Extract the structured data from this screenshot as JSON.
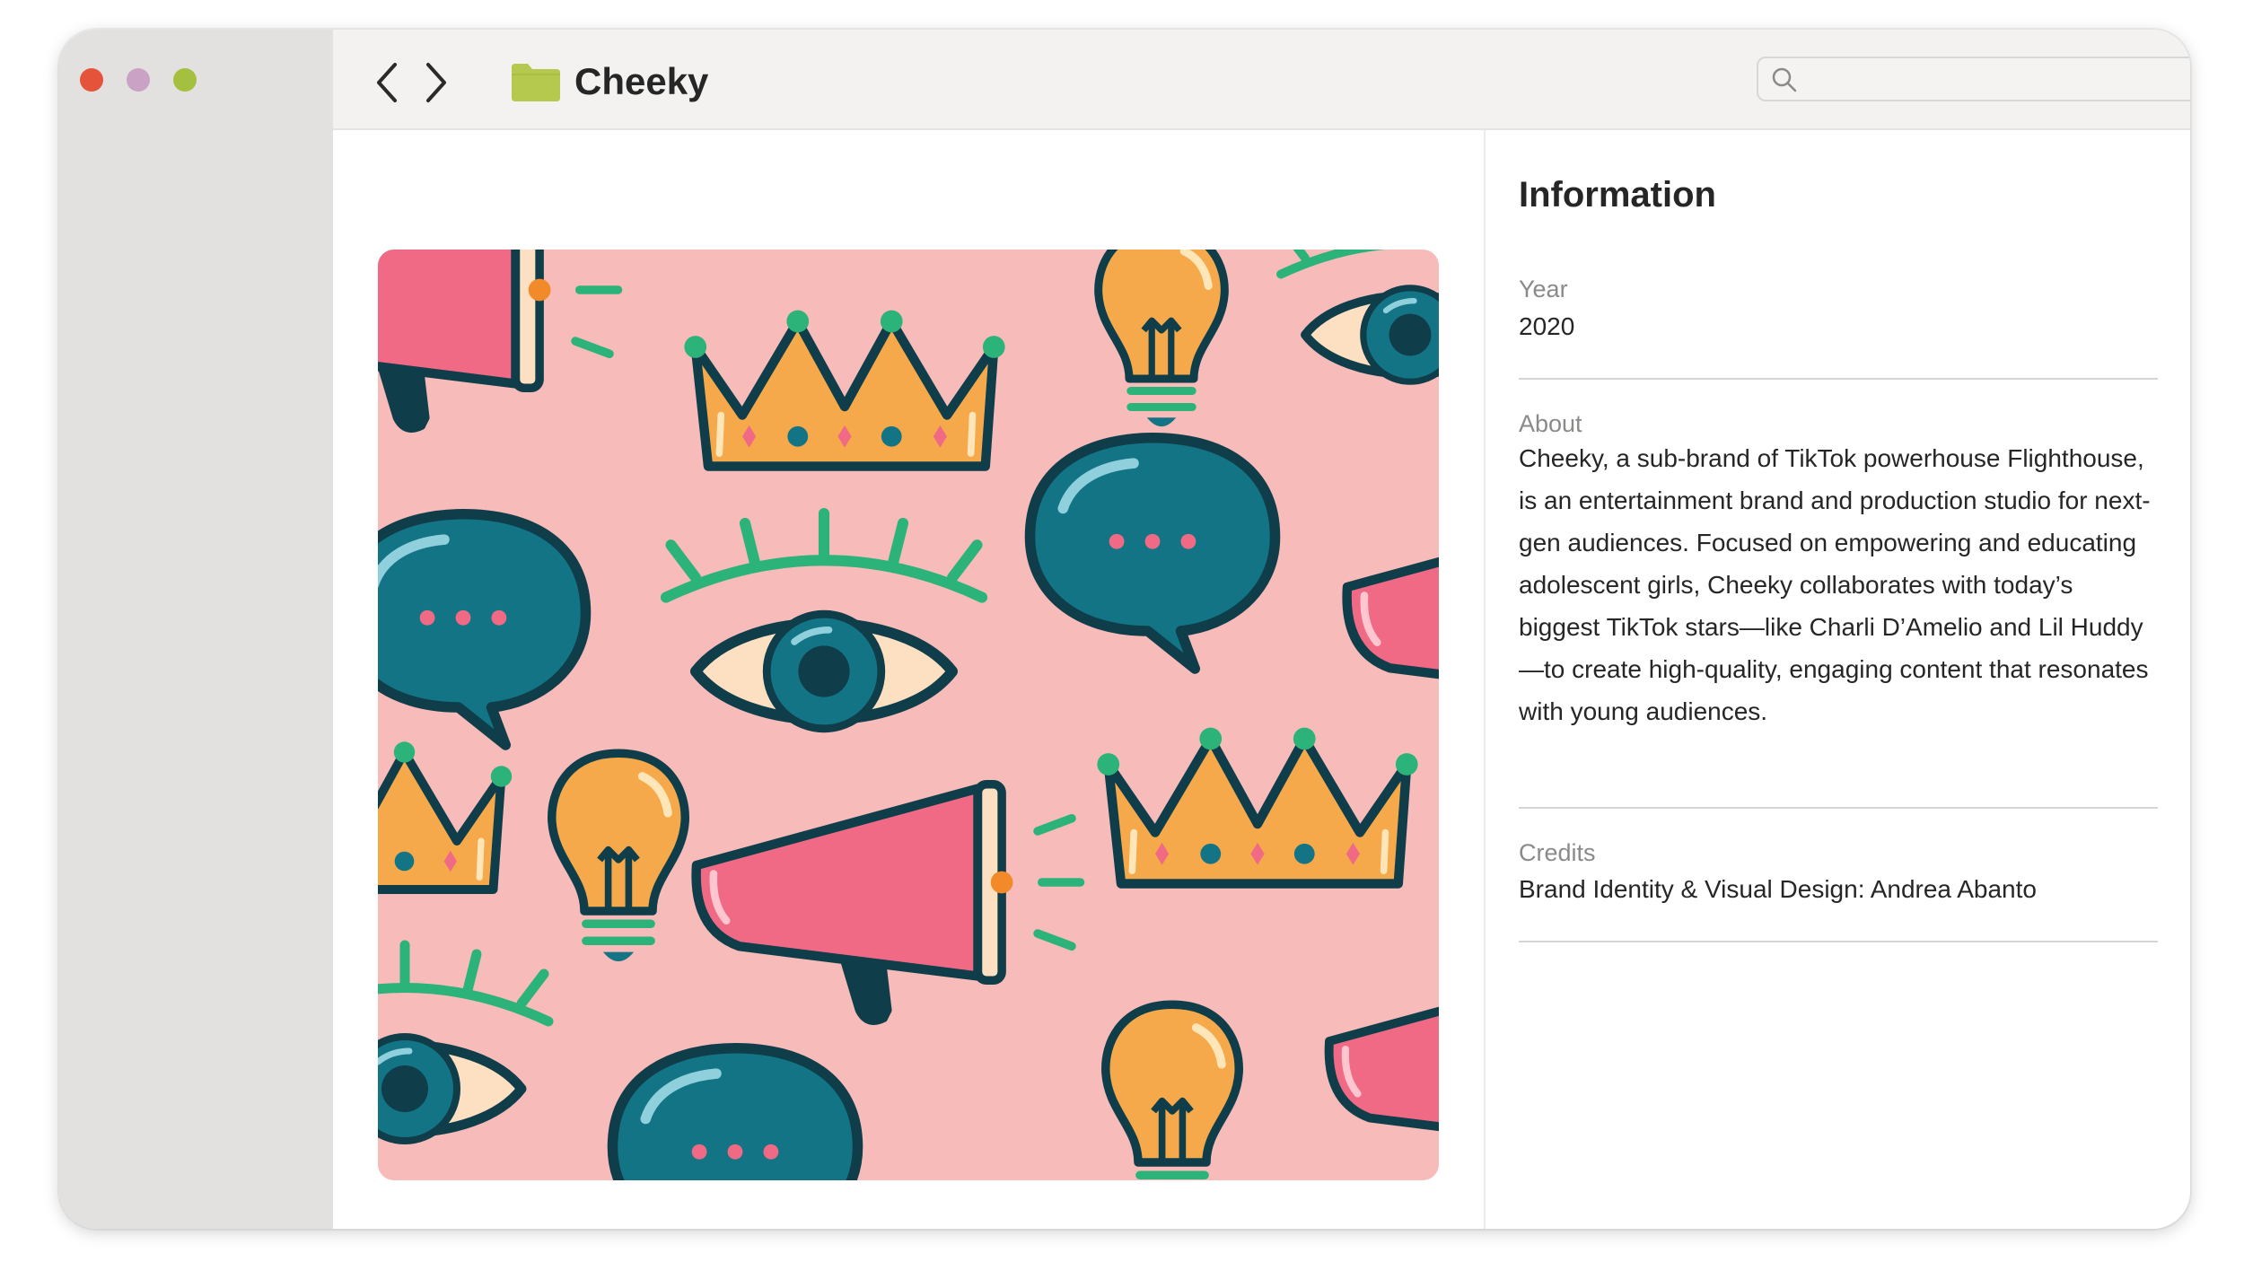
{
  "window": {
    "traffic_lights": {
      "close_color": "#e4533a",
      "minimize_color": "#c9a2c6",
      "zoom_color": "#a5bf3e"
    }
  },
  "toolbar": {
    "back_icon": "chevron-left-icon",
    "forward_icon": "chevron-right-icon",
    "folder_icon": "folder-icon",
    "folder_color": "#b5c94f",
    "title": "Cheeky",
    "search": {
      "icon": "search-icon",
      "value": "",
      "placeholder": ""
    }
  },
  "preview": {
    "background_color": "#f7bbb9",
    "motifs": [
      "megaphone",
      "crown",
      "light-bulb",
      "eye",
      "speech-bubble"
    ]
  },
  "info": {
    "heading": "Information",
    "year": {
      "label": "Year",
      "value": "2020"
    },
    "about": {
      "label": "About",
      "value": "Cheeky, a sub-brand of TikTok powerhouse Flighthouse, is an entertainment brand and production studio for next-gen audiences. Focused on empowering and educating adolescent girls, Cheeky collaborates with today’s biggest TikTok stars—like Charli D’Amelio and Lil Huddy—to create high-quality, engaging content that resonates with young audiences."
    },
    "credits": {
      "label": "Credits",
      "value": "Brand Identity & Visual Design: Andrea Abanto"
    }
  }
}
